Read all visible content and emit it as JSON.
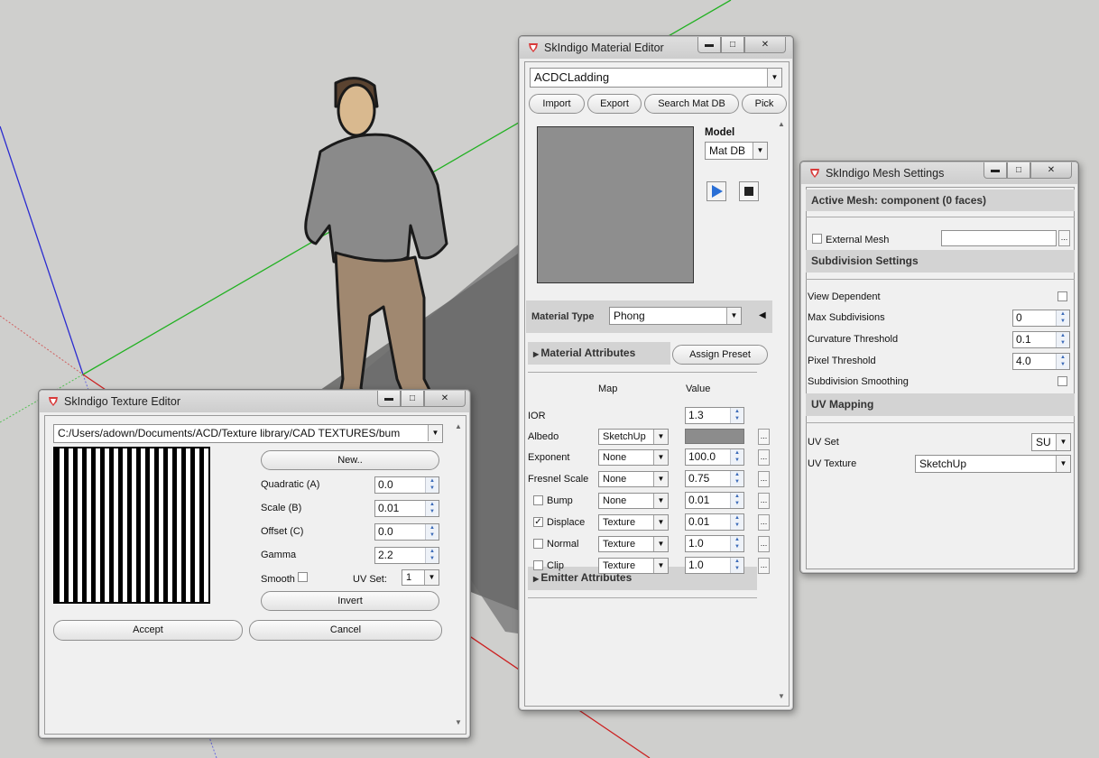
{
  "texture_editor": {
    "title": "SkIndigo Texture Editor",
    "path": "C:/Users/adown/Documents/ACD/Texture library/CAD TEXTURES/bum",
    "new_label": "New..",
    "quadratic_label": "Quadratic (A)",
    "quadratic_value": "0.0",
    "scale_label": "Scale (B)",
    "scale_value": "0.01",
    "offset_label": "Offset (C)",
    "offset_value": "0.0",
    "gamma_label": "Gamma",
    "gamma_value": "2.2",
    "smooth_label": "Smooth",
    "uvset_label": "UV Set:",
    "uvset_value": "1",
    "invert_label": "Invert",
    "accept_label": "Accept",
    "cancel_label": "Cancel"
  },
  "material_editor": {
    "title": "SkIndigo Material Editor",
    "material_name": "ACDCLadding",
    "buttons": [
      "Import",
      "Export",
      "Search Mat DB",
      "Pick"
    ],
    "model_label": "Model",
    "model_value": "Mat DB",
    "material_type_label": "Material Type",
    "material_type_value": "Phong",
    "material_attributes_label": "Material Attributes",
    "assign_preset_label": "Assign Preset",
    "map_header": "Map",
    "value_header": "Value",
    "attributes": [
      {
        "label": "IOR",
        "map": "",
        "value": "1.3",
        "checkbox": false,
        "checked": false
      },
      {
        "label": "Albedo",
        "map": "SketchUp",
        "value": "",
        "checkbox": false,
        "checked": false
      },
      {
        "label": "Exponent",
        "map": "None",
        "value": "100.0",
        "checkbox": false,
        "checked": false
      },
      {
        "label": "Fresnel Scale",
        "map": "None",
        "value": "0.75",
        "checkbox": false,
        "checked": false
      },
      {
        "label": "Bump",
        "map": "None",
        "value": "0.01",
        "checkbox": true,
        "checked": false
      },
      {
        "label": "Displace",
        "map": "Texture",
        "value": "0.01",
        "checkbox": true,
        "checked": true
      },
      {
        "label": "Normal",
        "map": "Texture",
        "value": "1.0",
        "checkbox": true,
        "checked": false
      },
      {
        "label": "Clip",
        "map": "Texture",
        "value": "1.0",
        "checkbox": true,
        "checked": false
      }
    ],
    "emitter_attributes_label": "Emitter Attributes",
    "albedo_color": "#8c8c8c",
    "preview_color": "#8e8e8e"
  },
  "mesh_settings": {
    "title": "SkIndigo Mesh Settings",
    "active_mesh_label": "Active Mesh: component (0 faces)",
    "external_mesh_label": "External Mesh",
    "subdivision_settings_label": "Subdivision Settings",
    "view_dependent_label": "View Dependent",
    "max_subdivisions_label": "Max Subdivisions",
    "max_subdivisions_value": "0",
    "curvature_threshold_label": "Curvature Threshold",
    "curvature_threshold_value": "0.1",
    "pixel_threshold_label": "Pixel Threshold",
    "pixel_threshold_value": "4.0",
    "subdivision_smoothing_label": "Subdivision Smoothing",
    "uv_mapping_label": "UV Mapping",
    "uv_set_label": "UV Set",
    "uv_set_value": "SU",
    "uv_texture_label": "UV Texture",
    "uv_texture_value": "SketchUp"
  },
  "colors": {
    "accent_play": "#2a6fd6",
    "viewport": "#cfcfcd",
    "ground_plane": "#8a8a8a"
  }
}
